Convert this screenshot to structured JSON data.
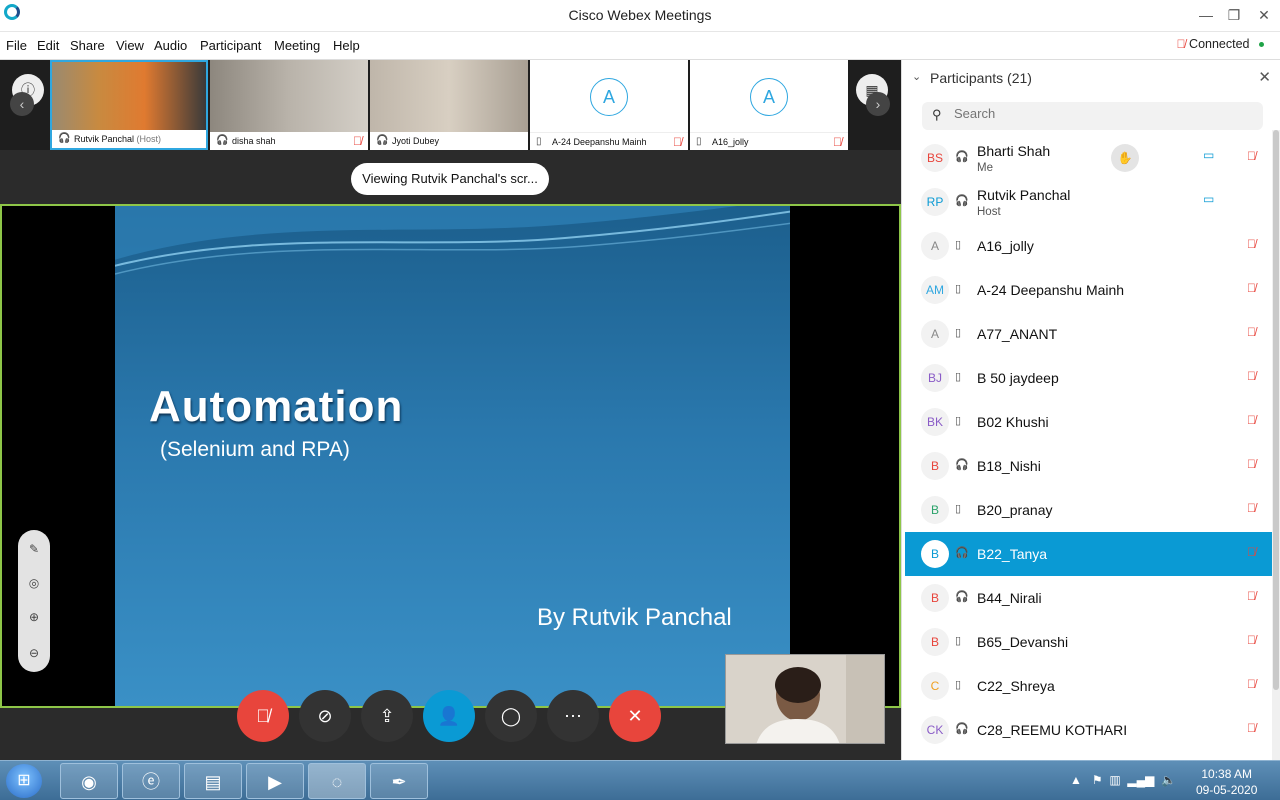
{
  "window": {
    "title": "Cisco Webex Meetings",
    "minimize": "—",
    "restore": "❐",
    "close": "✕"
  },
  "menu": {
    "items": [
      "File",
      "Edit",
      "Share",
      "View",
      "Audio",
      "Participant",
      "Meeting",
      "Help"
    ],
    "status": "Connected"
  },
  "thumbnails": [
    {
      "name": "Rutvik Panchal",
      "tag": "(Host)"
    },
    {
      "name": "disha shah",
      "tag": ""
    },
    {
      "name": "Jyoti Dubey",
      "tag": ""
    },
    {
      "name": "A-24 Deepanshu Mainh",
      "tag": "",
      "initial": "A"
    },
    {
      "name": "A16_jolly",
      "tag": "",
      "initial": "A"
    }
  ],
  "viewing_pill": "Viewing Rutvik Panchal's scr...",
  "slide": {
    "title": "Automation",
    "subtitle": "(Selenium and RPA)",
    "byline": "By Rutvik Panchal"
  },
  "panel": {
    "title": "Participants (21)",
    "search_placeholder": "Search",
    "participants": [
      {
        "initials": "BS",
        "name": "Bharti Shah",
        "role": "Me",
        "color": "#e8453c",
        "device": "headset"
      },
      {
        "initials": "RP",
        "name": "Rutvik Panchal",
        "role": "Host",
        "color": "#0a9ad4",
        "device": "headset"
      },
      {
        "initials": "A",
        "name": "A16_jolly",
        "role": "",
        "color": "#888888",
        "device": "phone"
      },
      {
        "initials": "AM",
        "name": "A-24 Deepanshu Mainh",
        "role": "",
        "color": "#2fa7e0",
        "device": "phone"
      },
      {
        "initials": "A",
        "name": "A77_ANANT",
        "role": "",
        "color": "#888888",
        "device": "phone"
      },
      {
        "initials": "BJ",
        "name": "B 50 jaydeep",
        "role": "",
        "color": "#8a5cc7",
        "device": "phone"
      },
      {
        "initials": "BK",
        "name": "B02 Khushi",
        "role": "",
        "color": "#8a5cc7",
        "device": "phone"
      },
      {
        "initials": "B",
        "name": "B18_Nishi",
        "role": "",
        "color": "#e8453c",
        "device": "headset"
      },
      {
        "initials": "B",
        "name": "B20_pranay",
        "role": "",
        "color": "#2ba36b",
        "device": "phone"
      },
      {
        "initials": "B",
        "name": "B22_Tanya",
        "role": "",
        "color": "#0a9ad4",
        "device": "headset"
      },
      {
        "initials": "B",
        "name": "B44_Nirali",
        "role": "",
        "color": "#e8453c",
        "device": "headset"
      },
      {
        "initials": "B",
        "name": "B65_Devanshi",
        "role": "",
        "color": "#e8453c",
        "device": "phone"
      },
      {
        "initials": "C",
        "name": "C22_Shreya",
        "role": "",
        "color": "#f0a020",
        "device": "phone"
      },
      {
        "initials": "CK",
        "name": "C28_REEMU KOTHARI",
        "role": "",
        "color": "#8a5cc7",
        "device": "headset"
      }
    ]
  },
  "taskbar": {
    "time": "10:38 AM",
    "date": "09-05-2020"
  }
}
